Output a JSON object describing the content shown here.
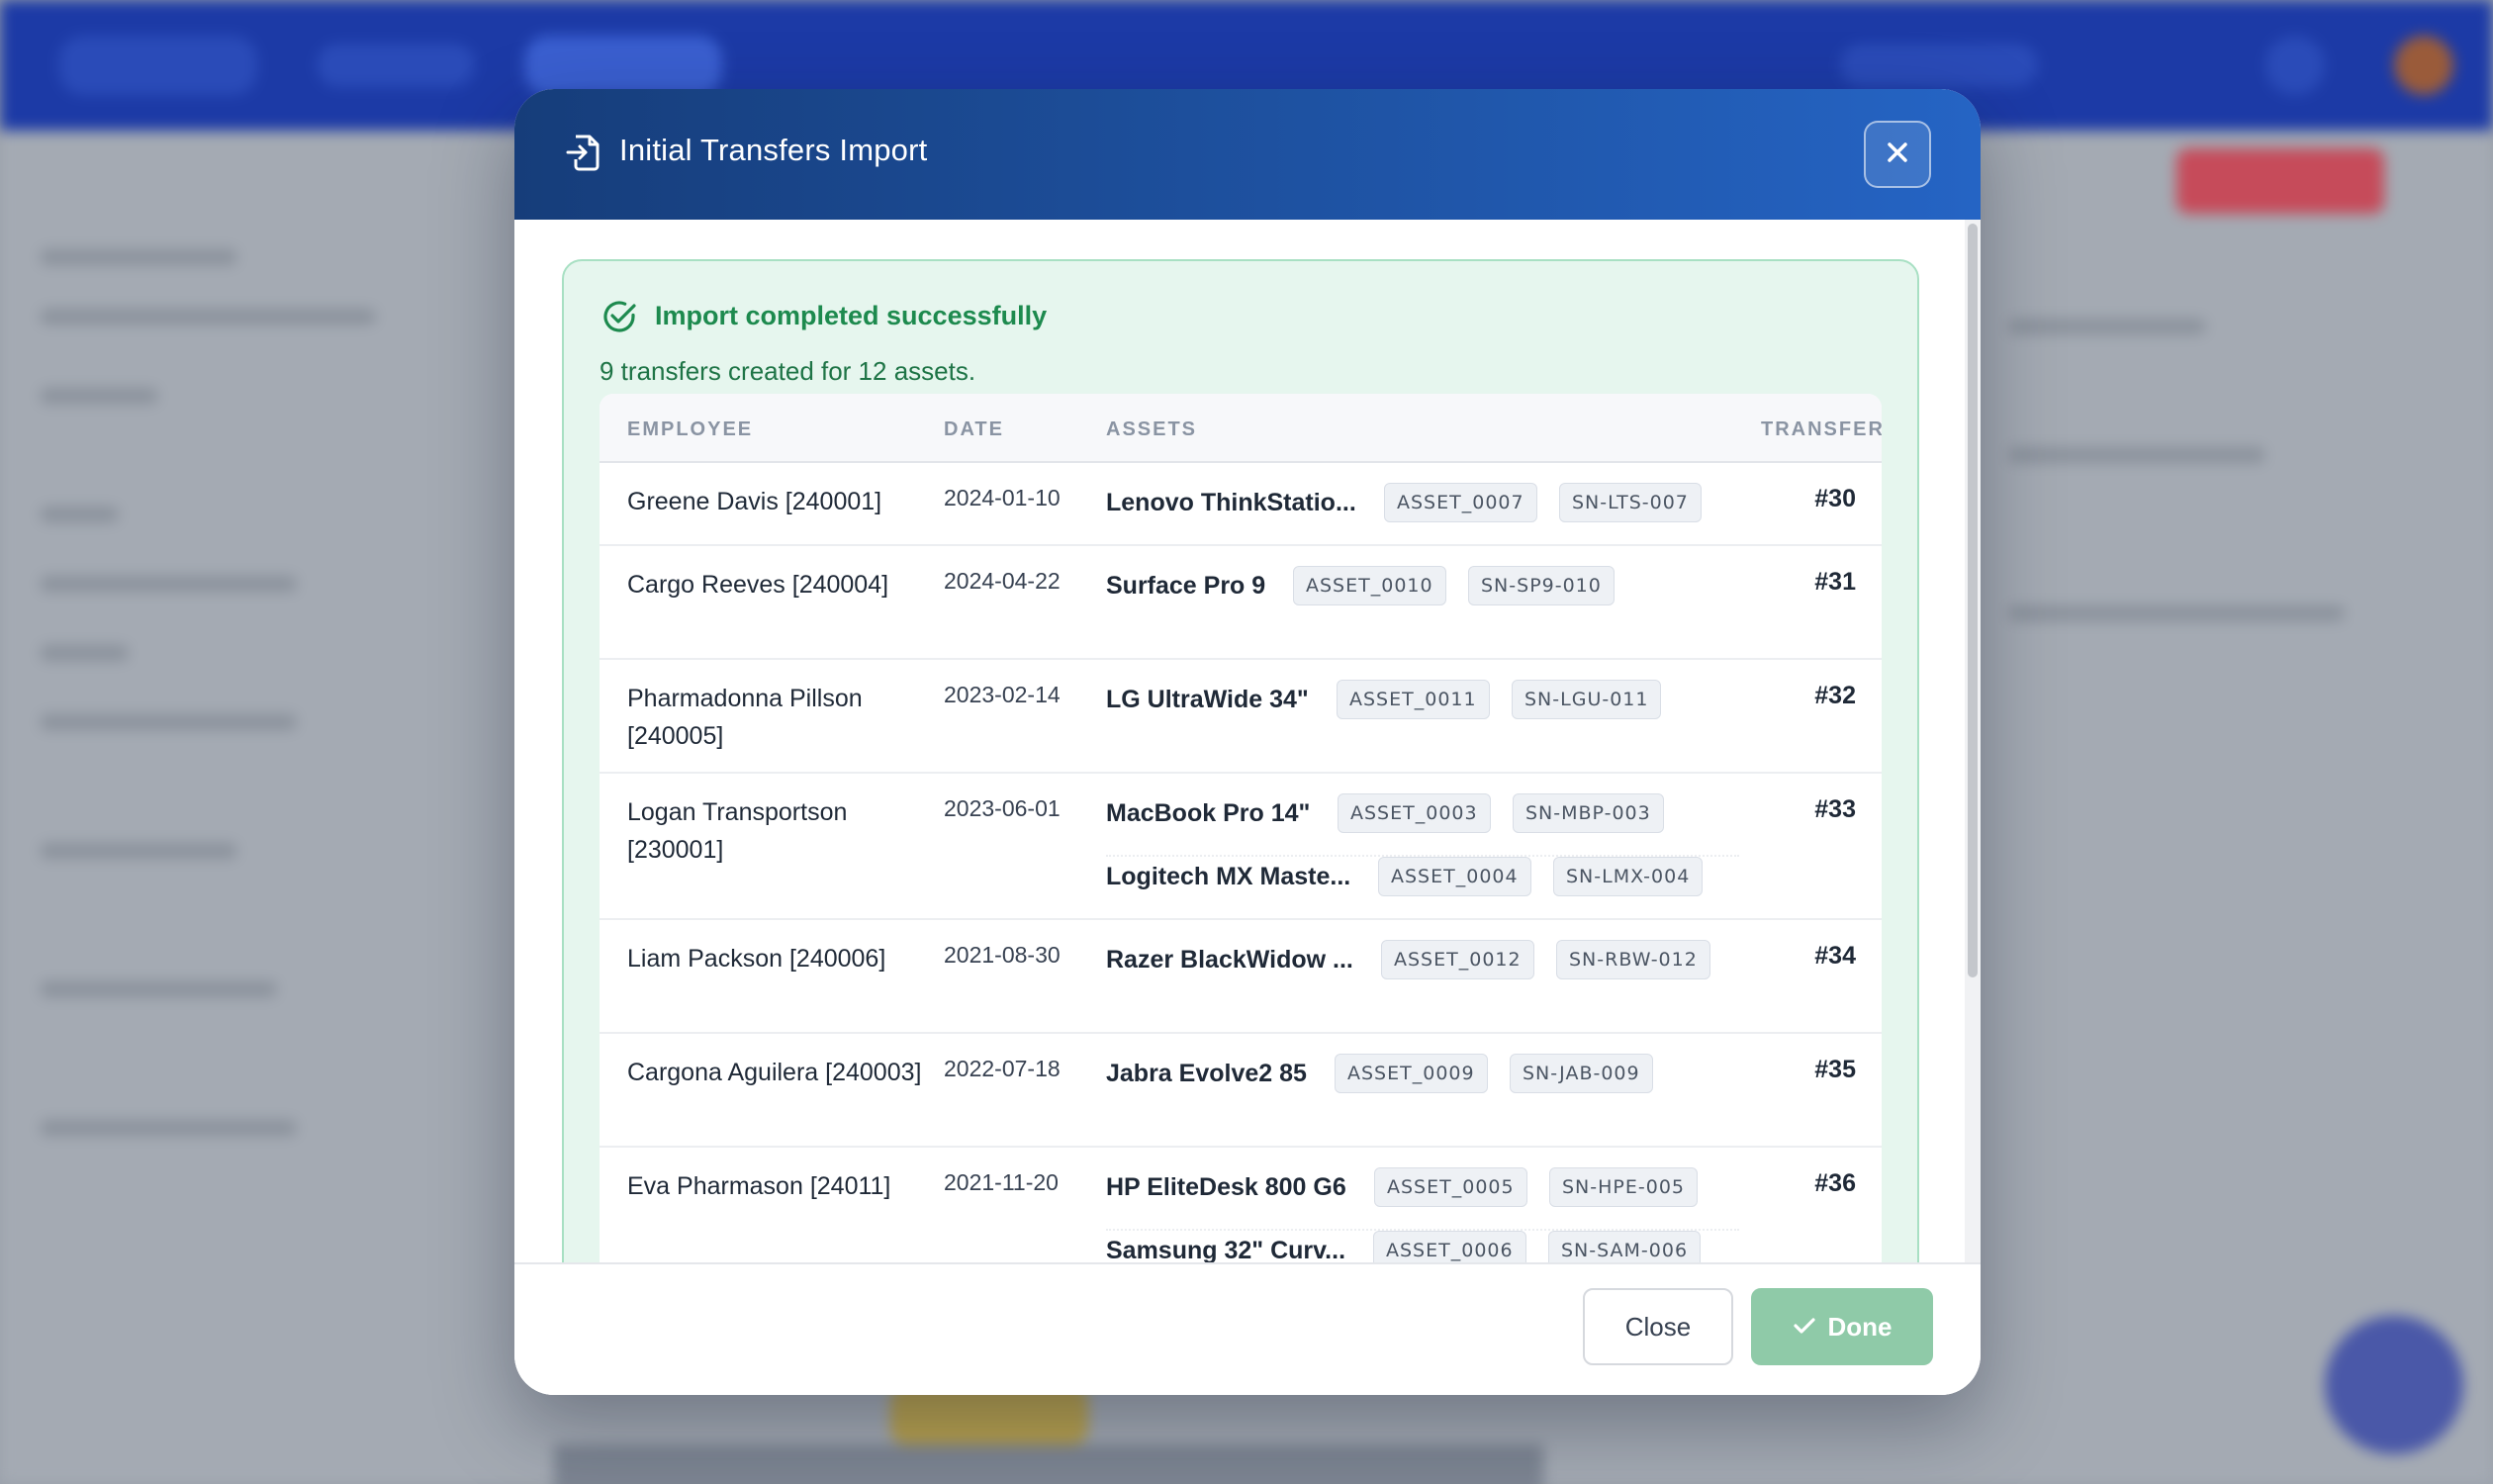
{
  "modal": {
    "title": "Initial Transfers Import",
    "icon": "file-import-icon",
    "close_icon": "close-icon"
  },
  "result": {
    "title": "Import completed successfully",
    "summary": "9 transfers created for 12 assets.",
    "icon": "check-circle-icon",
    "color": "#1d8a4e"
  },
  "table": {
    "headers": {
      "employee": "EMPLOYEE",
      "date": "DATE",
      "assets": "ASSETS",
      "transfer": "TRANSFER"
    },
    "rows": [
      {
        "employee": "Greene Davis [240001]",
        "date": "2024-01-10",
        "transfer": "#30",
        "assets": [
          {
            "name": "Lenovo ThinkStatio...",
            "asset_id": "ASSET_0007",
            "serial": "SN-LTS-007"
          }
        ]
      },
      {
        "employee": "Cargo Reeves [240004]",
        "date": "2024-04-22",
        "transfer": "#31",
        "assets": [
          {
            "name": "Surface Pro 9",
            "asset_id": "ASSET_0010",
            "serial": "SN-SP9-010"
          }
        ]
      },
      {
        "employee": "Pharmadonna Pillson [240005]",
        "date": "2023-02-14",
        "transfer": "#32",
        "assets": [
          {
            "name": "LG UltraWide 34\"",
            "asset_id": "ASSET_0011",
            "serial": "SN-LGU-011"
          }
        ]
      },
      {
        "employee": "Logan Transportson [230001]",
        "date": "2023-06-01",
        "transfer": "#33",
        "assets": [
          {
            "name": "MacBook Pro 14\"",
            "asset_id": "ASSET_0003",
            "serial": "SN-MBP-003"
          },
          {
            "name": "Logitech MX Maste...",
            "asset_id": "ASSET_0004",
            "serial": "SN-LMX-004"
          }
        ]
      },
      {
        "employee": "Liam Packson [240006]",
        "date": "2021-08-30",
        "transfer": "#34",
        "assets": [
          {
            "name": "Razer BlackWidow ...",
            "asset_id": "ASSET_0012",
            "serial": "SN-RBW-012"
          }
        ]
      },
      {
        "employee": "Cargona Aguilera [240003]",
        "date": "2022-07-18",
        "transfer": "#35",
        "assets": [
          {
            "name": "Jabra Evolve2 85",
            "asset_id": "ASSET_0009",
            "serial": "SN-JAB-009"
          }
        ]
      },
      {
        "employee": "Eva Pharmason [24011]",
        "date": "2021-11-20",
        "transfer": "#36",
        "assets": [
          {
            "name": "HP EliteDesk 800 G6",
            "asset_id": "ASSET_0005",
            "serial": "SN-HPE-005"
          },
          {
            "name": "Samsung 32\" Curv...",
            "asset_id": "ASSET_0006",
            "serial": "SN-SAM-006"
          }
        ]
      }
    ]
  },
  "footer": {
    "close_label": "Close",
    "done_label": "Done",
    "done_icon": "check-icon",
    "done_color": "#8fcaa8"
  }
}
